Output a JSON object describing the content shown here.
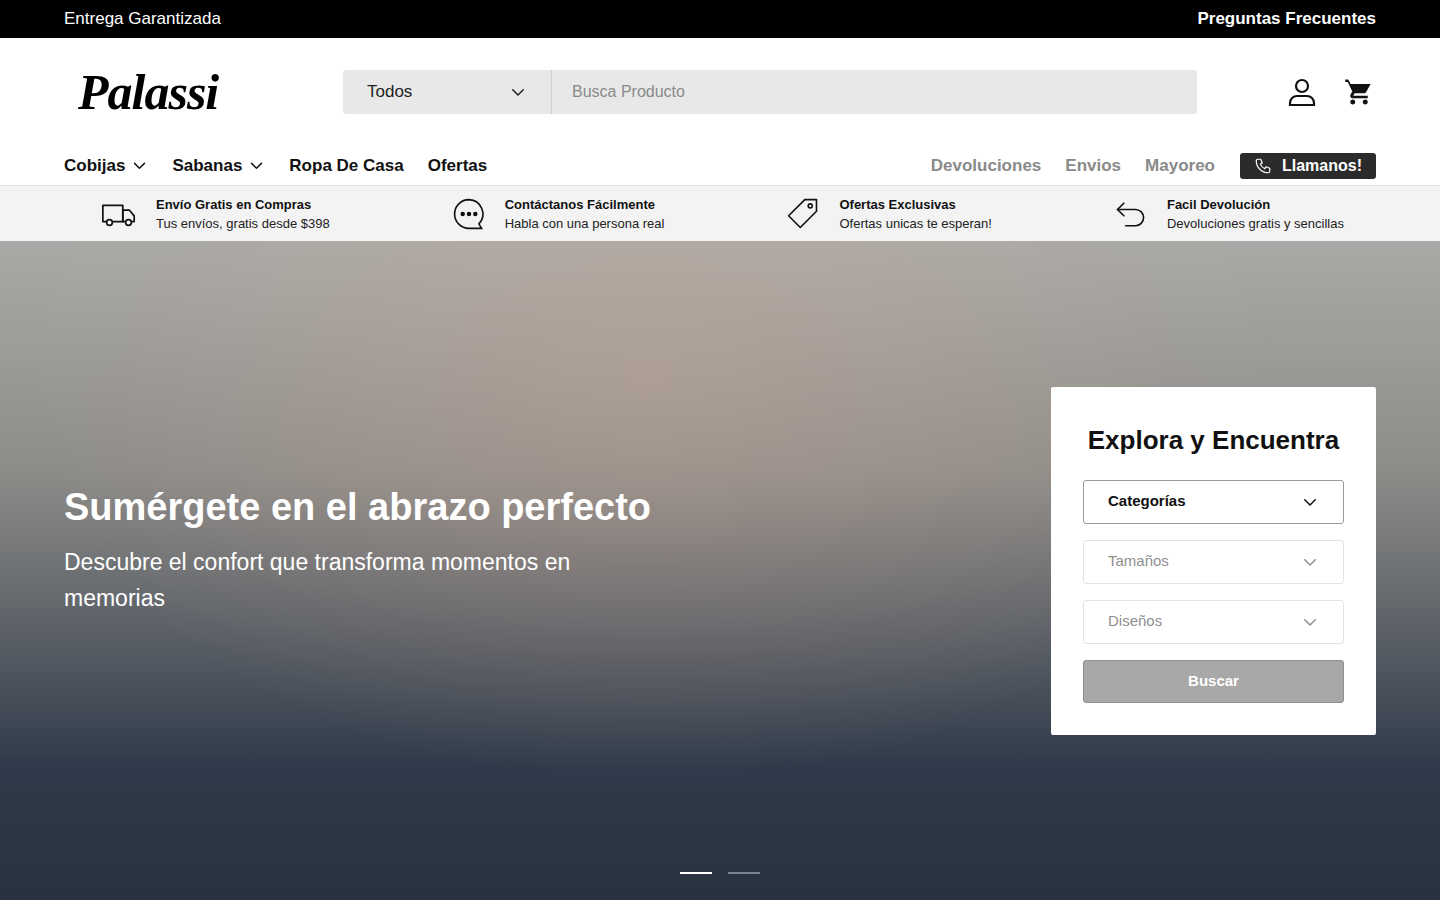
{
  "topbar": {
    "left": "Entrega Garantizada",
    "right": "Preguntas Frecuentes"
  },
  "logo": "Palassi",
  "search": {
    "category": "Todos",
    "placeholder": "Busca Producto"
  },
  "nav": {
    "items": [
      {
        "label": "Cobijas",
        "dropdown": true
      },
      {
        "label": "Sabanas",
        "dropdown": true
      },
      {
        "label": "Ropa De Casa",
        "dropdown": false
      },
      {
        "label": "Ofertas",
        "dropdown": false
      }
    ],
    "links": [
      "Devoluciones",
      "Envios",
      "Mayoreo"
    ],
    "call": "Llamanos!"
  },
  "features": [
    {
      "title": "Envío Gratis en Compras",
      "subtitle": "Tus envíos, gratis desde $398"
    },
    {
      "title": "Contáctanos Fácilmente",
      "subtitle": "Habla con una persona real"
    },
    {
      "title": "Ofertas Exclusivas",
      "subtitle": "Ofertas unicas te esperan!"
    },
    {
      "title": "Facil Devolución",
      "subtitle": "Devoluciones gratis y sencillas"
    }
  ],
  "hero": {
    "title": "Sumérgete en el abrazo perfecto",
    "subtitle": "Descubre el confort que transforma momentos en memorias",
    "slides": [
      {
        "selected": true
      },
      {
        "selected": false
      }
    ]
  },
  "finder": {
    "title": "Explora y Encuentra",
    "fields": [
      {
        "label": "Categorías",
        "disabled": false
      },
      {
        "label": "Tamaños",
        "disabled": true
      },
      {
        "label": "Diseños",
        "disabled": true
      }
    ],
    "button": {
      "label": "Buscar",
      "disabled": true
    }
  }
}
